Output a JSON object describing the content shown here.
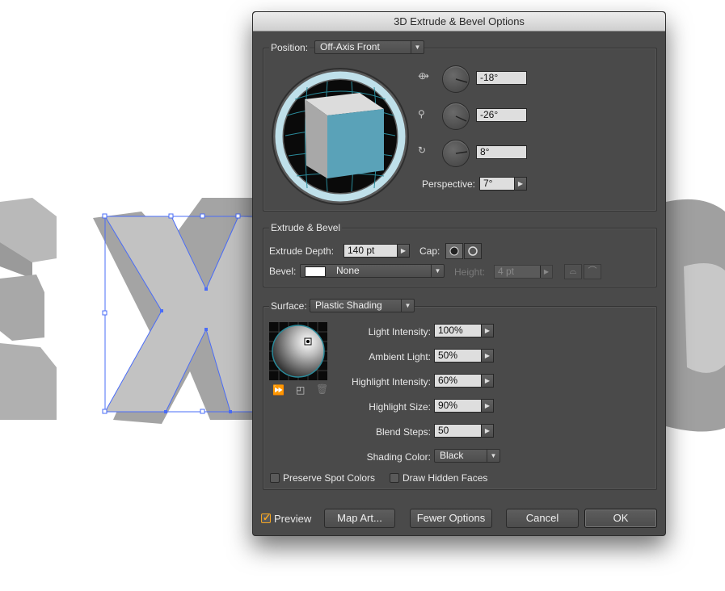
{
  "dialog": {
    "title": "3D Extrude & Bevel Options",
    "position": {
      "label": "Position:",
      "value": "Off-Axis Front",
      "rot_x": "-18°",
      "rot_y": "-26°",
      "rot_z": "8°",
      "perspective_label": "Perspective:",
      "perspective": "7°"
    },
    "extrude": {
      "section_label": "Extrude & Bevel",
      "depth_label": "Extrude Depth:",
      "depth": "140 pt",
      "cap_label": "Cap:",
      "bevel_label": "Bevel:",
      "bevel": "None",
      "height_label": "Height:",
      "height": "4 pt"
    },
    "surface": {
      "label": "Surface:",
      "value": "Plastic Shading",
      "light_intensity_label": "Light Intensity:",
      "light_intensity": "100%",
      "ambient_label": "Ambient Light:",
      "ambient": "50%",
      "highlight_intensity_label": "Highlight Intensity:",
      "highlight_intensity": "60%",
      "highlight_size_label": "Highlight Size:",
      "highlight_size": "90%",
      "blend_steps_label": "Blend Steps:",
      "blend_steps": "50",
      "shading_color_label": "Shading Color:",
      "shading_color": "Black",
      "preserve_spot": "Preserve Spot Colors",
      "draw_hidden": "Draw Hidden Faces"
    },
    "footer": {
      "preview": "Preview",
      "map_art": "Map Art...",
      "fewer_options": "Fewer Options",
      "cancel": "Cancel",
      "ok": "OK"
    }
  },
  "colors": {
    "dialog_bg": "#4a4a4a",
    "cube_front": "#5aa2b8",
    "selection": "#4a6cf7",
    "preview_check": "#f5a623"
  }
}
